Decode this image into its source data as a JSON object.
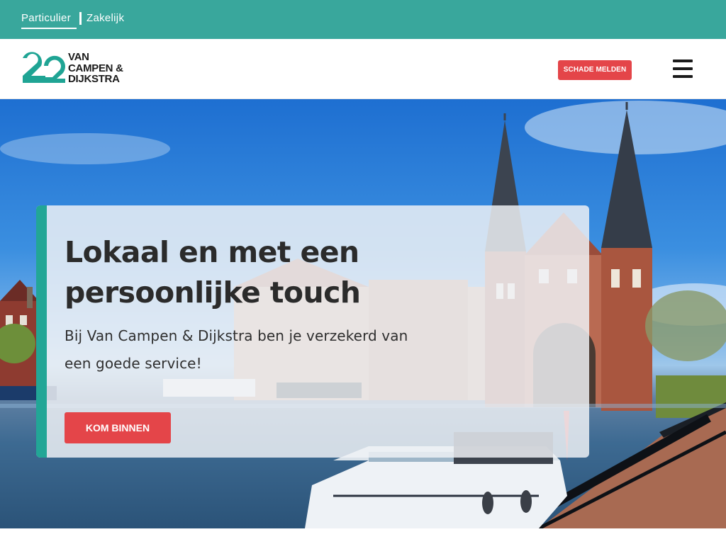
{
  "segments": {
    "particulier": "Particulier",
    "zakelijk": "Zakelijk"
  },
  "logo": {
    "line1": "VAN",
    "line2": "CAMPEN &",
    "line3": "DIJKSTRA",
    "mark_color": "#1fa494"
  },
  "header": {
    "cta_label": "SCHADE MELDEN",
    "menu_icon": "hamburger-menu-icon"
  },
  "hero": {
    "title": "Lokaal en met een persoonlijke touch",
    "text": "Bij Van Campen & Dijkstra ben je verzekerd van een goede service!",
    "cta_label": "KOM BINNEN"
  },
  "colors": {
    "topbar": "#39a79c",
    "accent": "#22a696",
    "cta": "#e44549"
  }
}
